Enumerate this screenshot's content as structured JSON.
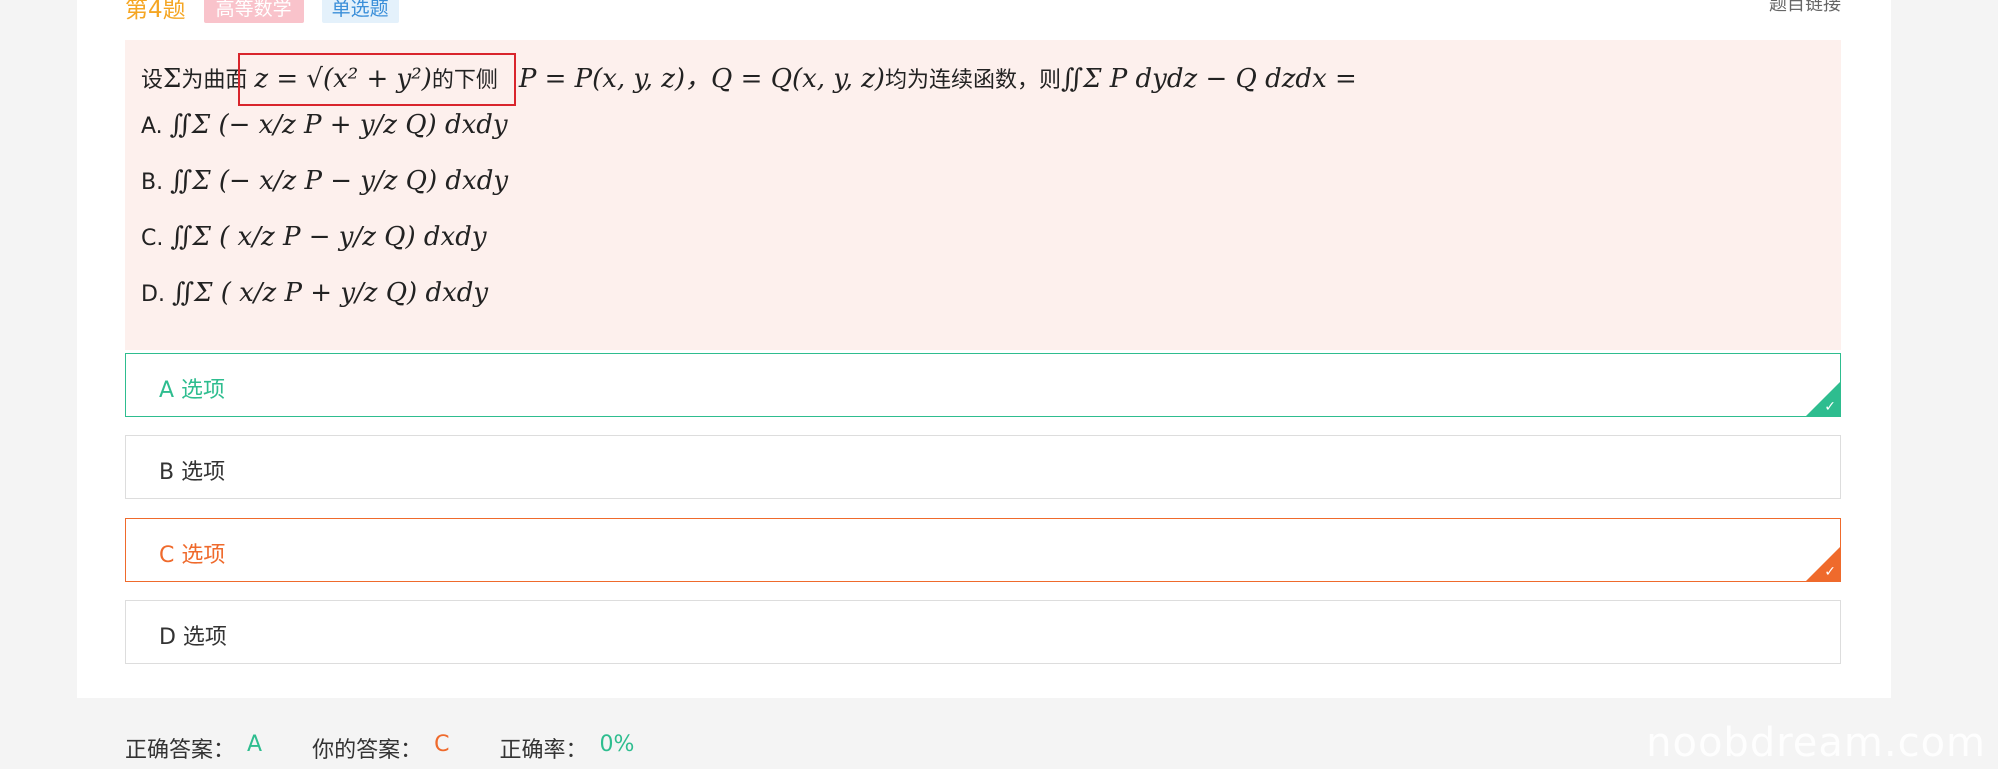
{
  "header": {
    "question_number": "第4题",
    "subject_tag": "高等数学",
    "type_tag": "单选题",
    "link_label": "题目链接"
  },
  "question": {
    "stem_prefix": "设",
    "stem_sigma": "Σ",
    "stem_is_surface": "为曲面",
    "stem_formula": "z = √(x² + y²)",
    "stem_lower_side": "的下侧",
    "stem_pq": "P = P(x, y, z)，Q = Q(x, y, z)",
    "stem_continuous": "均为连续函数，则",
    "stem_integral": "∬Σ P dydz − Q dzdx =",
    "options": [
      {
        "letter": "A.",
        "expr": "∬Σ (− x/z P + y/z Q) dxdy"
      },
      {
        "letter": "B.",
        "expr": "∬Σ (− x/z P − y/z Q) dxdy"
      },
      {
        "letter": "C.",
        "expr": "∬Σ ( x/z P − y/z Q) dxdy"
      },
      {
        "letter": "D.",
        "expr": "∬Σ ( x/z P + y/z Q) dxdy"
      }
    ]
  },
  "choices": [
    {
      "label": "A 选项",
      "state": "correct"
    },
    {
      "label": "B 选项",
      "state": "normal"
    },
    {
      "label": "C 选项",
      "state": "wrong"
    },
    {
      "label": "D 选项",
      "state": "normal"
    }
  ],
  "footer": {
    "correct_answer_label": "正确答案：",
    "correct_answer_value": "A",
    "your_answer_label": "你的答案：",
    "your_answer_value": "C",
    "accuracy_label": "正确率：",
    "accuracy_value": "0%"
  },
  "watermark": "noobdream.com",
  "colors": {
    "correct": "#2ebd8f",
    "wrong": "#ef6a2c",
    "question_bg": "#fdf0ed",
    "highlight_border": "#d9252c",
    "number_color": "#f5a623"
  },
  "icons": {
    "correct_corner": "check-icon",
    "wrong_corner": "check-icon"
  }
}
